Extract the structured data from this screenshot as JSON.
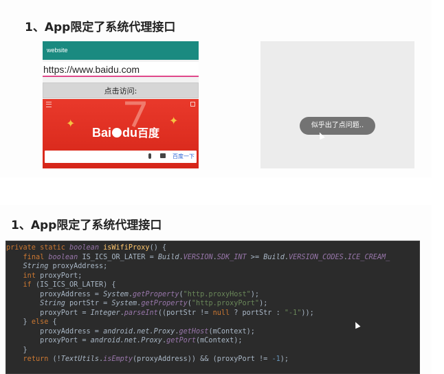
{
  "slide1": {
    "heading": "1、App限定了系统代理接口",
    "phone": {
      "appbar_title": "website",
      "url_value": "https://www.baidu.com",
      "visit_button": "点击访问:",
      "banner_logo_text": "Bai",
      "banner_logo_text2": "du",
      "banner_logo_cn": "百度",
      "search_button": "百度一下",
      "accent_color": "#1a8a80",
      "banner_color": "#e9392b"
    },
    "toast_text": "似乎出了点问题.."
  },
  "slide2": {
    "heading": "1、App限定了系统代理接口",
    "code_lines": [
      [
        [
          "kw",
          "private static "
        ],
        [
          "it",
          "boolean "
        ],
        [
          "fn",
          "isWifiProxy"
        ],
        [
          "pl",
          "() {"
        ]
      ],
      [
        [
          "pl",
          "    "
        ],
        [
          "kw",
          "final "
        ],
        [
          "it",
          "boolean "
        ],
        [
          "pl",
          "IS_ICS_OR_LATER = "
        ],
        [
          "cls",
          "Build"
        ],
        [
          "pl",
          "."
        ],
        [
          "fld",
          "VERSION"
        ],
        [
          "pl",
          "."
        ],
        [
          "fld",
          "SDK_INT"
        ],
        [
          "pl",
          " >= "
        ],
        [
          "cls",
          "Build"
        ],
        [
          "pl",
          "."
        ],
        [
          "fld",
          "VERSION_CODES"
        ],
        [
          "pl",
          "."
        ],
        [
          "fld",
          "ICE_CREAM_"
        ]
      ],
      [
        [
          "pl",
          "    "
        ],
        [
          "cls",
          "String "
        ],
        [
          "pl",
          "proxyAddress;"
        ]
      ],
      [
        [
          "pl",
          "    "
        ],
        [
          "kw",
          "int "
        ],
        [
          "pl",
          "proxyPort;"
        ]
      ],
      [
        [
          "pl",
          "    "
        ],
        [
          "kw",
          "if "
        ],
        [
          "pl",
          "(IS_ICS_OR_LATER) {"
        ]
      ],
      [
        [
          "pl",
          "        proxyAddress = "
        ],
        [
          "cls",
          "System"
        ],
        [
          "pl",
          "."
        ],
        [
          "fld",
          "getProperty"
        ],
        [
          "pl",
          "("
        ],
        [
          "str",
          "\"http.proxyHost\""
        ],
        [
          "pl",
          ");"
        ]
      ],
      [
        [
          "pl",
          "        "
        ],
        [
          "cls",
          "String "
        ],
        [
          "pl",
          "portStr = "
        ],
        [
          "cls",
          "System"
        ],
        [
          "pl",
          "."
        ],
        [
          "fld",
          "getProperty"
        ],
        [
          "pl",
          "("
        ],
        [
          "str",
          "\"http.proxyPort\""
        ],
        [
          "pl",
          ");"
        ]
      ],
      [
        [
          "pl",
          "        proxyPort = "
        ],
        [
          "cls",
          "Integer"
        ],
        [
          "pl",
          "."
        ],
        [
          "fld",
          "parseInt"
        ],
        [
          "pl",
          "((portStr != "
        ],
        [
          "kw",
          "null "
        ],
        [
          "pl",
          "? portStr : "
        ],
        [
          "str",
          "\"-1\""
        ],
        [
          "pl",
          "));"
        ]
      ],
      [
        [
          "pl",
          "    } "
        ],
        [
          "kw",
          "else "
        ],
        [
          "pl",
          "{"
        ]
      ],
      [
        [
          "pl",
          "        proxyAddress = "
        ],
        [
          "cls",
          "android.net.Proxy"
        ],
        [
          "pl",
          "."
        ],
        [
          "fld",
          "getHost"
        ],
        [
          "pl",
          "(mContext);"
        ]
      ],
      [
        [
          "pl",
          "        proxyPort = "
        ],
        [
          "cls",
          "android.net.Proxy"
        ],
        [
          "pl",
          "."
        ],
        [
          "fld",
          "getPort"
        ],
        [
          "pl",
          "(mContext);"
        ]
      ],
      [
        [
          "pl",
          "    }"
        ]
      ],
      [
        [
          "pl",
          "    "
        ],
        [
          "kw",
          "return "
        ],
        [
          "pl",
          "(!"
        ],
        [
          "cls",
          "TextUtils"
        ],
        [
          "pl",
          "."
        ],
        [
          "fld",
          "isEmpty"
        ],
        [
          "pl",
          "(proxyAddress)) && (proxyPort != "
        ],
        [
          "num",
          "-1"
        ],
        [
          "pl",
          ");"
        ]
      ]
    ]
  }
}
